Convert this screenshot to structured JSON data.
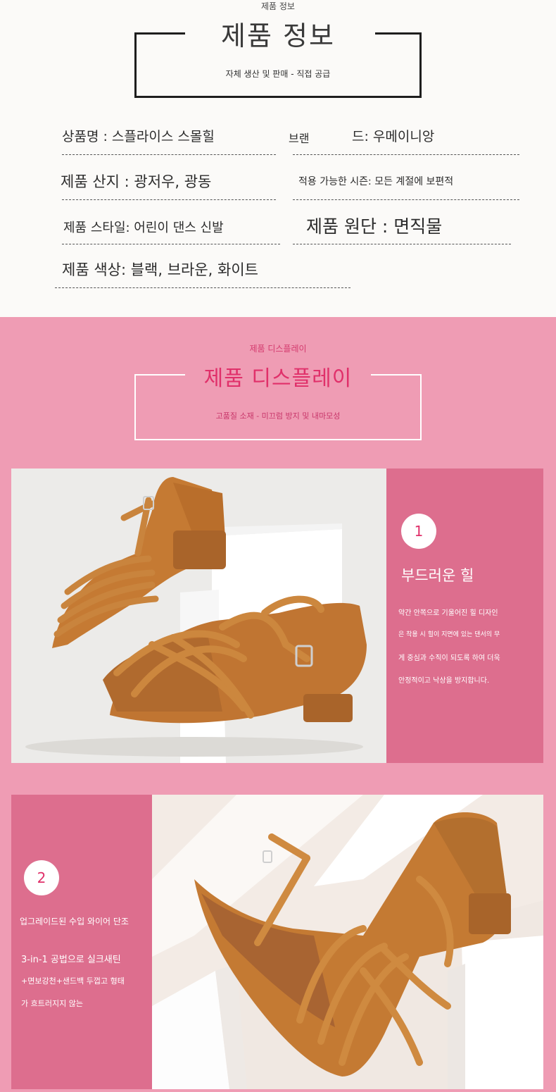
{
  "info": {
    "small_title": "제품 정보",
    "title": "제품 정보",
    "subtitle": "자체 생산 및 판매 - 직접 공급",
    "specs": {
      "name": "상품명 : 스플라이스 스몰힐",
      "brand_prefix": "브랜",
      "brand_value": "드: 우메이니앙",
      "origin": "제품 산지 : 광저우, 광동",
      "season": "적용 가능한 시즌: 모든 계절에 보편적",
      "style": "제품 스타일: 어린이 댄스 신발",
      "fabric": "제품 원단 : 면직물",
      "color": "제품 색상: 블랙, 브라운, 화이트"
    }
  },
  "display": {
    "small_title": "제품 디스플레이",
    "title": "제품 디스플레이",
    "subtitle": "고품질 소재 - 미끄럼 방지 및 내마모성"
  },
  "feature1": {
    "number": "1",
    "title": "부드러운 힐",
    "lines": [
      "약간 안쪽으로 기울어진 힐 디자인",
      "은 착용 시 힐이 지면에 있는 댄서의 무",
      "게 중심과 수직이 되도록 하여 더욱",
      "안정적이고 낙상을 방지합니다."
    ]
  },
  "feature2": {
    "number": "2",
    "title": "업그레이드된 수입 와이어 단조",
    "lines": [
      "3-in-1 공법으로 실크새틴",
      "+면보강천+샌드백 두껍고 형태",
      "가 흐트러지지 않는"
    ]
  },
  "colors": {
    "pink_bg": "#ef9cb4",
    "panel_pink": "#dd6e8e",
    "accent": "#e0306a",
    "shoe": "#c47a33"
  }
}
